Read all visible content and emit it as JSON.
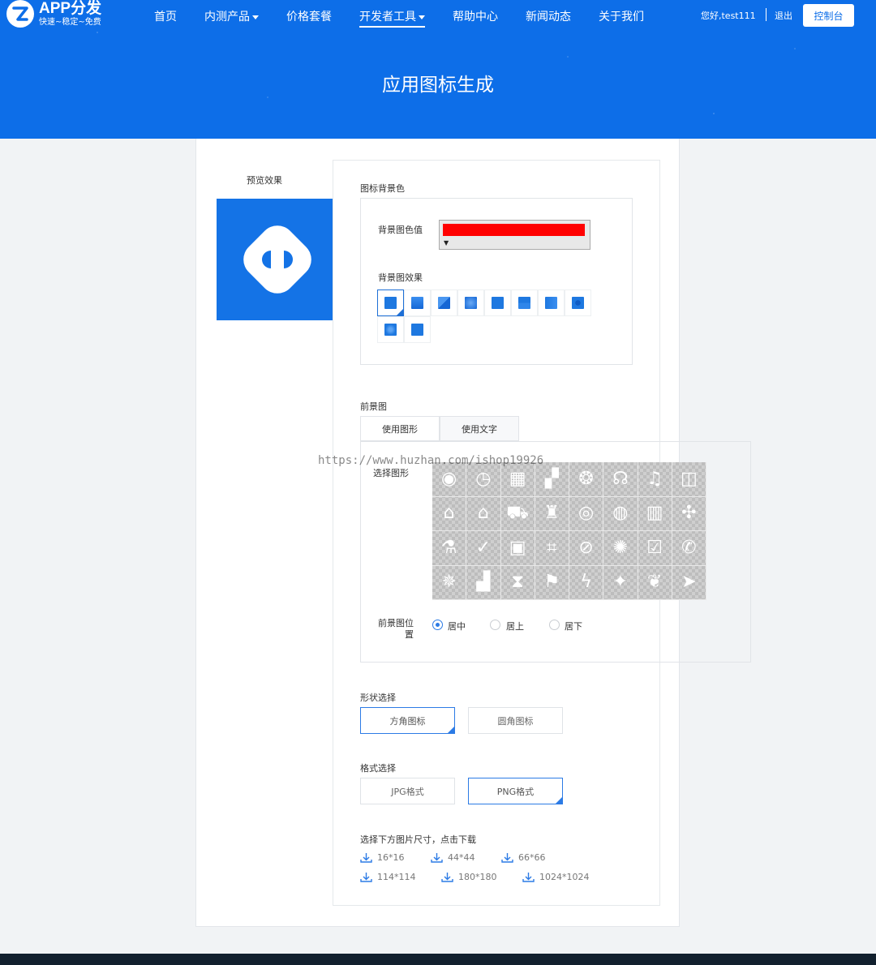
{
  "header": {
    "logo_title": "APP分发",
    "logo_subtitle": "快速~稳定~免费",
    "nav": [
      {
        "label": "首页",
        "dropdown": false
      },
      {
        "label": "内测产品",
        "dropdown": true
      },
      {
        "label": "价格套餐",
        "dropdown": false
      },
      {
        "label": "开发者工具",
        "dropdown": true,
        "active": true
      },
      {
        "label": "帮助中心",
        "dropdown": false
      },
      {
        "label": "新闻动态",
        "dropdown": false
      },
      {
        "label": "关于我们",
        "dropdown": false
      }
    ],
    "greeting": "您好,test111",
    "logout": "退出",
    "console": "控制台",
    "page_title": "应用图标生成",
    "bg_color": "#0d6ee8"
  },
  "preview": {
    "label": "预览效果",
    "bg_color": "#1473e6"
  },
  "background": {
    "section_label": "图标背景色",
    "color_label": "背景图色值",
    "color_value": "#ff0000",
    "effect_label": "背景图效果",
    "effects": [
      "effect-1",
      "effect-2",
      "effect-3",
      "effect-4",
      "effect-5",
      "effect-6",
      "effect-7",
      "effect-8",
      "effect-9",
      "effect-10"
    ]
  },
  "foreground": {
    "section_label": "前景图",
    "tabs": [
      "使用图形",
      "使用文字"
    ],
    "shape_label": "选择图形",
    "watermark": "https://www.huzhan.com/ishop19926",
    "icons": [
      {
        "name": "disc-icon",
        "glyph": "◉"
      },
      {
        "name": "clock-icon",
        "glyph": "◷"
      },
      {
        "name": "film-icon",
        "glyph": "▦"
      },
      {
        "name": "clapper-icon",
        "glyph": "▞"
      },
      {
        "name": "palette-icon",
        "glyph": "❂"
      },
      {
        "name": "headphones-icon",
        "glyph": "☊"
      },
      {
        "name": "music-icon",
        "glyph": "♫"
      },
      {
        "name": "bag-icon",
        "glyph": "◫"
      },
      {
        "name": "store-icon",
        "glyph": "⌂"
      },
      {
        "name": "shop-icon",
        "glyph": "⌂"
      },
      {
        "name": "cart-icon",
        "glyph": "⛟"
      },
      {
        "name": "shopping-bag-icon",
        "glyph": "♜"
      },
      {
        "name": "vinyl-icon",
        "glyph": "◎"
      },
      {
        "name": "globe-icon",
        "glyph": "◍"
      },
      {
        "name": "door-icon",
        "glyph": "▥"
      },
      {
        "name": "gamepad-icon",
        "glyph": "✣"
      },
      {
        "name": "flask-icon",
        "glyph": "⚗"
      },
      {
        "name": "check-circle-icon",
        "glyph": "✓"
      },
      {
        "name": "money-icon",
        "glyph": "▣"
      },
      {
        "name": "scan-icon",
        "glyph": "⌗"
      },
      {
        "name": "compass-icon",
        "glyph": "⊘"
      },
      {
        "name": "aperture-icon",
        "glyph": "✺"
      },
      {
        "name": "checkbox-icon",
        "glyph": "☑"
      },
      {
        "name": "phone-icon",
        "glyph": "✆"
      },
      {
        "name": "helm-icon",
        "glyph": "✵"
      },
      {
        "name": "chart-icon",
        "glyph": "▟"
      },
      {
        "name": "hourglass-icon",
        "glyph": "⧗"
      },
      {
        "name": "flag-icon",
        "glyph": "⚑"
      },
      {
        "name": "bolt-icon",
        "glyph": "ϟ"
      },
      {
        "name": "wand-icon",
        "glyph": "✦"
      },
      {
        "name": "feather-icon",
        "glyph": "❦"
      },
      {
        "name": "plane-icon",
        "glyph": "➤"
      }
    ],
    "position_label": "前景图位置",
    "positions": [
      {
        "label": "居中",
        "checked": true
      },
      {
        "label": "居上",
        "checked": false
      },
      {
        "label": "居下",
        "checked": false
      }
    ]
  },
  "shape": {
    "label": "形状选择",
    "options": [
      {
        "label": "方角图标",
        "selected": true
      },
      {
        "label": "圆角图标",
        "selected": false
      }
    ]
  },
  "format": {
    "label": "格式选择",
    "options": [
      {
        "label": "JPG格式",
        "selected": false
      },
      {
        "label": "PNG格式",
        "selected": true
      }
    ]
  },
  "download": {
    "label": "选择下方图片尺寸，点击下载",
    "sizes": [
      "16*16",
      "44*44",
      "66*66",
      "114*114",
      "180*180",
      "1024*1024"
    ]
  }
}
